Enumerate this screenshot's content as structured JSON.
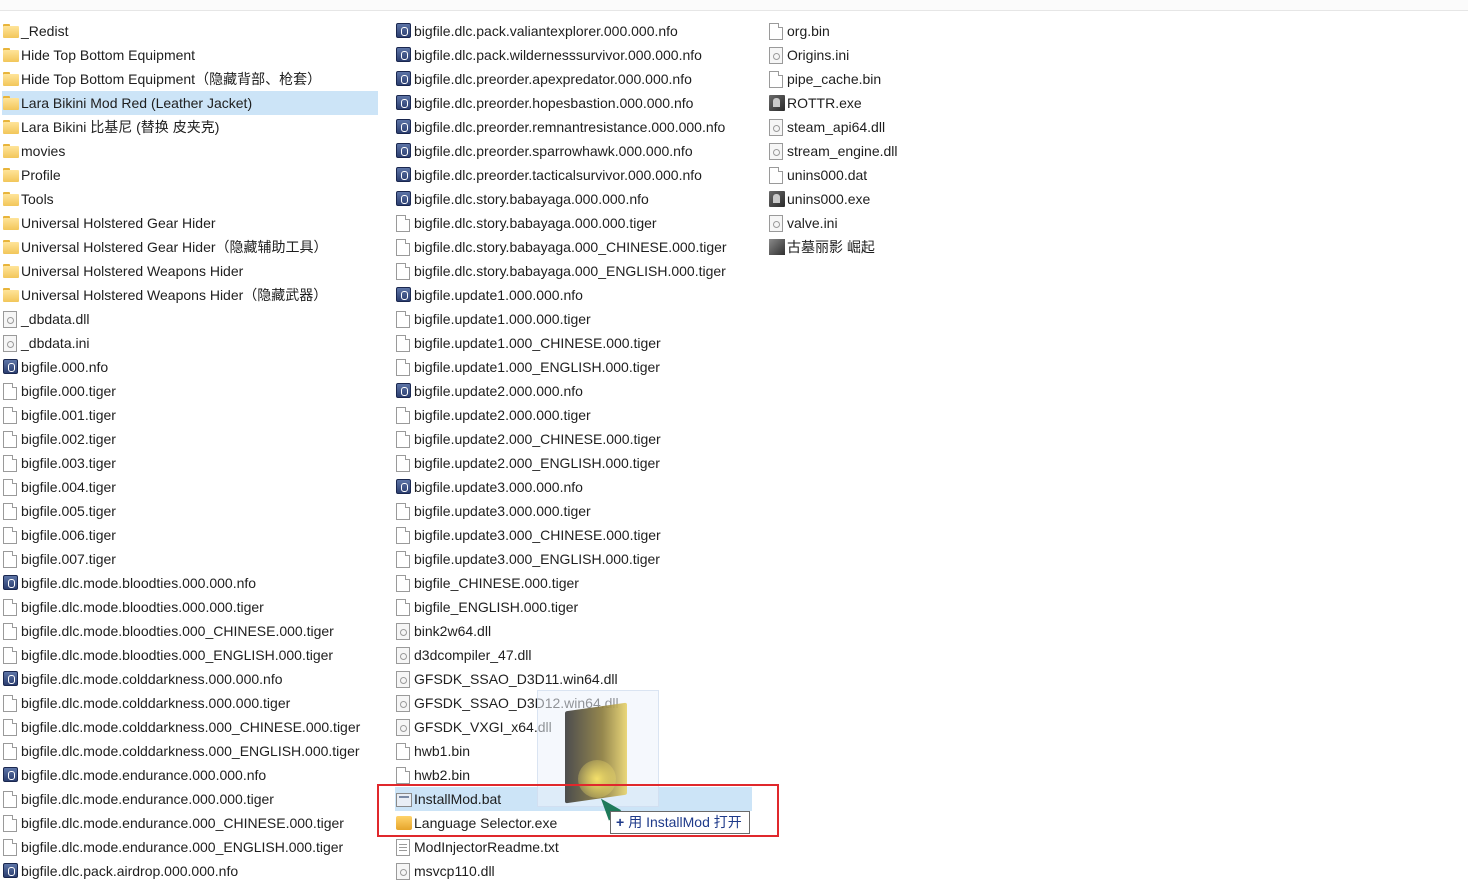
{
  "columns": [
    {
      "items": [
        {
          "name": "_Redist",
          "icon": "folder-icon"
        },
        {
          "name": "Hide Top Bottom Equipment",
          "icon": "folder-icon"
        },
        {
          "name": "Hide Top Bottom Equipment（隐藏背部、枪套）",
          "icon": "folder-icon"
        },
        {
          "name": "Lara Bikini Mod Red (Leather Jacket)",
          "icon": "folder-icon",
          "selected": true
        },
        {
          "name": "Lara Bikini 比基尼 (替换 皮夹克)",
          "icon": "folder-icon"
        },
        {
          "name": "movies",
          "icon": "folder-icon"
        },
        {
          "name": "Profile",
          "icon": "folder-icon"
        },
        {
          "name": "Tools",
          "icon": "folder-icon"
        },
        {
          "name": "Universal Holstered Gear Hider",
          "icon": "folder-icon"
        },
        {
          "name": "Universal Holstered Gear Hider（隐藏辅助工具）",
          "icon": "folder-icon"
        },
        {
          "name": "Universal Holstered Weapons Hider",
          "icon": "folder-icon"
        },
        {
          "name": "Universal Holstered Weapons Hider（隐藏武器）",
          "icon": "folder-icon"
        },
        {
          "name": "_dbdata.dll",
          "icon": "dll-file-icon"
        },
        {
          "name": "_dbdata.ini",
          "icon": "ini-file-icon"
        },
        {
          "name": "bigfile.000.nfo",
          "icon": "nfo-file-icon"
        },
        {
          "name": "bigfile.000.tiger",
          "icon": "generic-file-icon"
        },
        {
          "name": "bigfile.001.tiger",
          "icon": "generic-file-icon"
        },
        {
          "name": "bigfile.002.tiger",
          "icon": "generic-file-icon"
        },
        {
          "name": "bigfile.003.tiger",
          "icon": "generic-file-icon"
        },
        {
          "name": "bigfile.004.tiger",
          "icon": "generic-file-icon"
        },
        {
          "name": "bigfile.005.tiger",
          "icon": "generic-file-icon"
        },
        {
          "name": "bigfile.006.tiger",
          "icon": "generic-file-icon"
        },
        {
          "name": "bigfile.007.tiger",
          "icon": "generic-file-icon"
        },
        {
          "name": "bigfile.dlc.mode.bloodties.000.000.nfo",
          "icon": "nfo-file-icon"
        },
        {
          "name": "bigfile.dlc.mode.bloodties.000.000.tiger",
          "icon": "generic-file-icon"
        },
        {
          "name": "bigfile.dlc.mode.bloodties.000_CHINESE.000.tiger",
          "icon": "generic-file-icon"
        },
        {
          "name": "bigfile.dlc.mode.bloodties.000_ENGLISH.000.tiger",
          "icon": "generic-file-icon"
        },
        {
          "name": "bigfile.dlc.mode.colddarkness.000.000.nfo",
          "icon": "nfo-file-icon"
        },
        {
          "name": "bigfile.dlc.mode.colddarkness.000.000.tiger",
          "icon": "generic-file-icon"
        },
        {
          "name": "bigfile.dlc.mode.colddarkness.000_CHINESE.000.tiger",
          "icon": "generic-file-icon"
        },
        {
          "name": "bigfile.dlc.mode.colddarkness.000_ENGLISH.000.tiger",
          "icon": "generic-file-icon"
        },
        {
          "name": "bigfile.dlc.mode.endurance.000.000.nfo",
          "icon": "nfo-file-icon"
        },
        {
          "name": "bigfile.dlc.mode.endurance.000.000.tiger",
          "icon": "generic-file-icon"
        },
        {
          "name": "bigfile.dlc.mode.endurance.000_CHINESE.000.tiger",
          "icon": "generic-file-icon"
        },
        {
          "name": "bigfile.dlc.mode.endurance.000_ENGLISH.000.tiger",
          "icon": "generic-file-icon"
        },
        {
          "name": "bigfile.dlc.pack.airdrop.000.000.nfo",
          "icon": "nfo-file-icon"
        }
      ]
    },
    {
      "items": [
        {
          "name": "bigfile.dlc.pack.valiantexplorer.000.000.nfo",
          "icon": "nfo-file-icon"
        },
        {
          "name": "bigfile.dlc.pack.wildernesssurvivor.000.000.nfo",
          "icon": "nfo-file-icon"
        },
        {
          "name": "bigfile.dlc.preorder.apexpredator.000.000.nfo",
          "icon": "nfo-file-icon"
        },
        {
          "name": "bigfile.dlc.preorder.hopesbastion.000.000.nfo",
          "icon": "nfo-file-icon"
        },
        {
          "name": "bigfile.dlc.preorder.remnantresistance.000.000.nfo",
          "icon": "nfo-file-icon"
        },
        {
          "name": "bigfile.dlc.preorder.sparrowhawk.000.000.nfo",
          "icon": "nfo-file-icon"
        },
        {
          "name": "bigfile.dlc.preorder.tacticalsurvivor.000.000.nfo",
          "icon": "nfo-file-icon"
        },
        {
          "name": "bigfile.dlc.story.babayaga.000.000.nfo",
          "icon": "nfo-file-icon"
        },
        {
          "name": "bigfile.dlc.story.babayaga.000.000.tiger",
          "icon": "generic-file-icon"
        },
        {
          "name": "bigfile.dlc.story.babayaga.000_CHINESE.000.tiger",
          "icon": "generic-file-icon"
        },
        {
          "name": "bigfile.dlc.story.babayaga.000_ENGLISH.000.tiger",
          "icon": "generic-file-icon"
        },
        {
          "name": "bigfile.update1.000.000.nfo",
          "icon": "nfo-file-icon"
        },
        {
          "name": "bigfile.update1.000.000.tiger",
          "icon": "generic-file-icon"
        },
        {
          "name": "bigfile.update1.000_CHINESE.000.tiger",
          "icon": "generic-file-icon"
        },
        {
          "name": "bigfile.update1.000_ENGLISH.000.tiger",
          "icon": "generic-file-icon"
        },
        {
          "name": "bigfile.update2.000.000.nfo",
          "icon": "nfo-file-icon"
        },
        {
          "name": "bigfile.update2.000.000.tiger",
          "icon": "generic-file-icon"
        },
        {
          "name": "bigfile.update2.000_CHINESE.000.tiger",
          "icon": "generic-file-icon"
        },
        {
          "name": "bigfile.update2.000_ENGLISH.000.tiger",
          "icon": "generic-file-icon"
        },
        {
          "name": "bigfile.update3.000.000.nfo",
          "icon": "nfo-file-icon"
        },
        {
          "name": "bigfile.update3.000.000.tiger",
          "icon": "generic-file-icon"
        },
        {
          "name": "bigfile.update3.000_CHINESE.000.tiger",
          "icon": "generic-file-icon"
        },
        {
          "name": "bigfile.update3.000_ENGLISH.000.tiger",
          "icon": "generic-file-icon"
        },
        {
          "name": "bigfile_CHINESE.000.tiger",
          "icon": "generic-file-icon"
        },
        {
          "name": "bigfile_ENGLISH.000.tiger",
          "icon": "generic-file-icon"
        },
        {
          "name": "bink2w64.dll",
          "icon": "dll-file-icon"
        },
        {
          "name": "d3dcompiler_47.dll",
          "icon": "dll-file-icon"
        },
        {
          "name": "GFSDK_SSAO_D3D11.win64.dll",
          "icon": "dll-file-icon"
        },
        {
          "name": "GFSDK_SSAO_D3D12.win64.dll",
          "icon": "dll-file-icon"
        },
        {
          "name": "GFSDK_VXGI_x64.dll",
          "icon": "dll-file-icon"
        },
        {
          "name": "hwb1.bin",
          "icon": "generic-file-icon"
        },
        {
          "name": "hwb2.bin",
          "icon": "generic-file-icon"
        },
        {
          "name": "InstallMod.bat",
          "icon": "batch-file-icon",
          "selected": true
        },
        {
          "name": "Language Selector.exe",
          "icon": "language-selector-icon"
        },
        {
          "name": "ModInjectorReadme.txt",
          "icon": "text-file-icon"
        },
        {
          "name": "msvcp110.dll",
          "icon": "dll-file-icon"
        }
      ]
    },
    {
      "items": [
        {
          "name": "org.bin",
          "icon": "generic-file-icon"
        },
        {
          "name": "Origins.ini",
          "icon": "ini-file-icon"
        },
        {
          "name": "pipe_cache.bin",
          "icon": "generic-file-icon"
        },
        {
          "name": "ROTTR.exe",
          "icon": "game-exe-icon"
        },
        {
          "name": "steam_api64.dll",
          "icon": "dll-file-icon"
        },
        {
          "name": "stream_engine.dll",
          "icon": "dll-file-icon"
        },
        {
          "name": "unins000.dat",
          "icon": "generic-file-icon"
        },
        {
          "name": "unins000.exe",
          "icon": "installer-exe-icon"
        },
        {
          "name": "valve.ini",
          "icon": "ini-file-icon"
        },
        {
          "name": "古墓丽影 崛起",
          "icon": "shortcut-image-icon"
        }
      ]
    }
  ],
  "drag_tooltip": {
    "plus": "+",
    "text": "用 InstallMod 打开"
  }
}
